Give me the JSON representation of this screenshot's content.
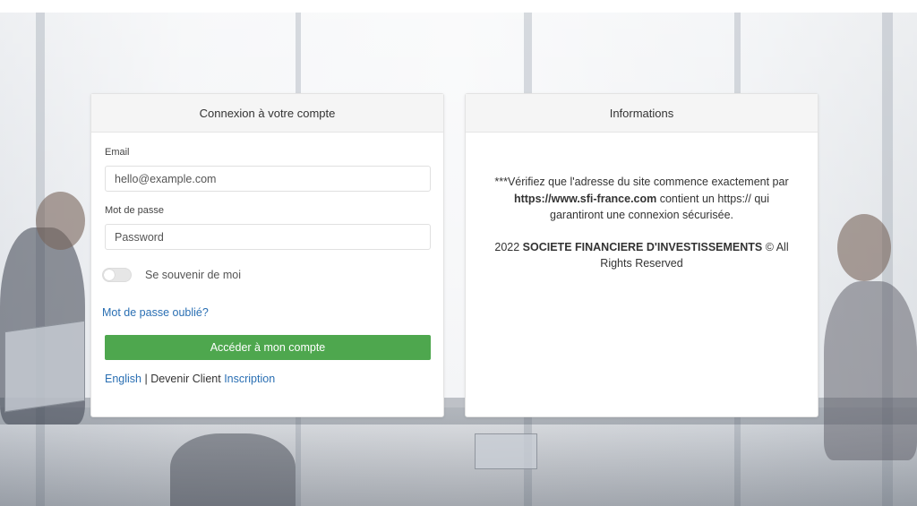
{
  "login": {
    "title": "Connexion à votre compte",
    "email_label": "Email",
    "email_placeholder": "hello@example.com",
    "password_label": "Mot de passe",
    "password_placeholder": "Password",
    "remember_label": "Se souvenir de moi",
    "remember_checked": false,
    "forgot_link": "Mot de passe oublié?",
    "submit_label": "Accéder à mon compte",
    "links": {
      "english": "English",
      "separator": " | ",
      "become_client": "Devenir Client ",
      "signup": "Inscription"
    }
  },
  "info": {
    "title": "Informations",
    "line1_prefix": "***Vérifiez que l'adresse du site commence exactement par ",
    "site_url": "https://www.sfi-france.com",
    "line1_suffix": " contient un https:// qui garantiront une connexion sécurisée.",
    "copyright_year": "2022 ",
    "company": "SOCIETE FINANCIERE D'INVESTISSEMENTS",
    "copyright_suffix": " © All Rights Reserved"
  },
  "colors": {
    "accent_button": "#4ea74e",
    "link": "#2a6fb3"
  }
}
